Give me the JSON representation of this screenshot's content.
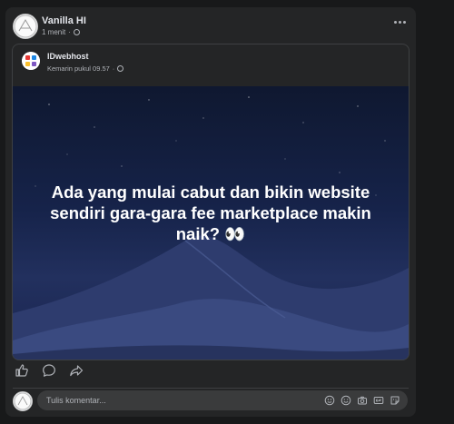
{
  "post": {
    "author": "Vanilla HI",
    "time": "1 menit",
    "separator": "·"
  },
  "shared": {
    "author": "IDwebhost",
    "time": "Kemarin pukul 09.57",
    "separator": "·",
    "caption": "Ada yang mulai cabut dan bikin website sendiri gara-gara fee marketplace makin naik? 👀"
  },
  "actions": {
    "icons": [
      "like-icon",
      "comment-icon",
      "share-icon"
    ]
  },
  "comment": {
    "placeholder": "Tulis komentar...",
    "icons": [
      "avatar-sticker-icon",
      "emoji-icon",
      "camera-icon",
      "gif-icon",
      "sticker-icon"
    ]
  },
  "colors": {
    "background": "#18191a",
    "card": "#242526",
    "text": "#e4e6eb",
    "muted": "#b0b3b8"
  }
}
